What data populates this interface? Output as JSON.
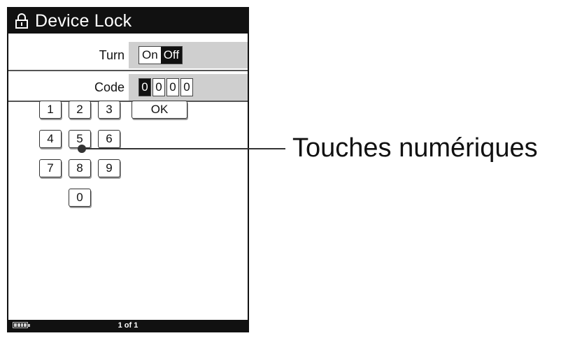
{
  "window": {
    "title": "Device Lock"
  },
  "turn": {
    "label": "Turn",
    "on_label": "On",
    "off_label": "Off",
    "selected": "Off"
  },
  "code": {
    "label": "Code",
    "digits": [
      "0",
      "0",
      "0",
      "0"
    ],
    "active_index": 0
  },
  "keypad": {
    "keys": [
      "1",
      "2",
      "3",
      "4",
      "5",
      "6",
      "7",
      "8",
      "9",
      "0"
    ],
    "ok_label": "OK"
  },
  "status": {
    "page": "1 of 1"
  },
  "callout": {
    "text": "Touches numériques"
  },
  "colors": {
    "titlebar": "#111111",
    "panel": "#cfcfcf",
    "selected": "#111111"
  }
}
